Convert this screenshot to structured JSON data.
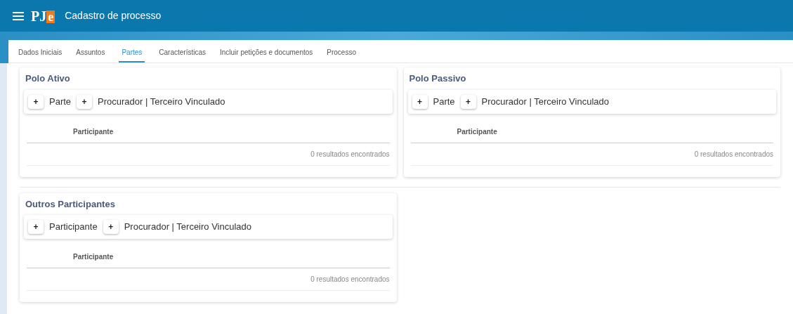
{
  "header": {
    "logo_main": "PJ",
    "logo_accent": "e",
    "title": "Cadastro de processo"
  },
  "tabs": [
    {
      "label": "Dados Iniciais",
      "selected": false
    },
    {
      "label": "Assuntos",
      "selected": false
    },
    {
      "label": "Partes",
      "selected": true
    },
    {
      "label": "Características",
      "selected": false
    },
    {
      "label": "Incluir petições e documentos",
      "selected": false
    },
    {
      "label": "Processo",
      "selected": false
    }
  ],
  "panels": [
    {
      "title": "Polo Ativo",
      "actions": [
        {
          "button": "+",
          "label": "Parte"
        },
        {
          "button": "+",
          "label": "Procurador | Terceiro Vinculado"
        }
      ],
      "column": "Participante",
      "footer": "0 resultados encontrados"
    },
    {
      "title": "Polo Passivo",
      "actions": [
        {
          "button": "+",
          "label": "Parte"
        },
        {
          "button": "+",
          "label": "Procurador | Terceiro Vinculado"
        }
      ],
      "column": "Participante",
      "footer": "0 resultados encontrados"
    },
    {
      "title": "Outros Participantes",
      "actions": [
        {
          "button": "+",
          "label": "Participante"
        },
        {
          "button": "+",
          "label": "Procurador | Terceiro Vinculado"
        }
      ],
      "column": "Participante",
      "footer": "0 resultados encontrados"
    }
  ]
}
